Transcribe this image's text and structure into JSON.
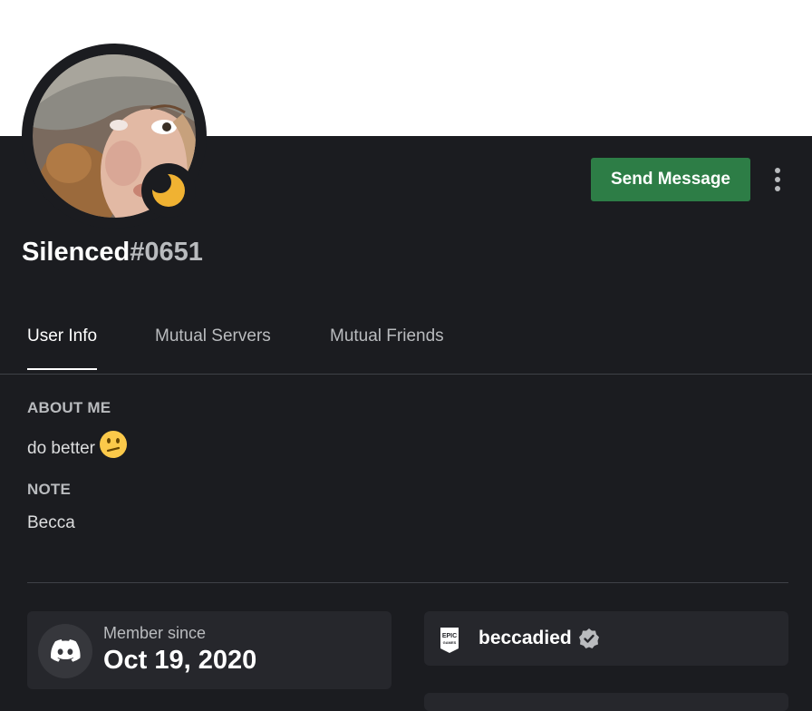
{
  "profile": {
    "username": "Silenced",
    "discriminator": "#0651",
    "status": "idle"
  },
  "actions": {
    "send_message_label": "Send Message"
  },
  "tabs": [
    {
      "label": "User Info",
      "active": true
    },
    {
      "label": "Mutual Servers",
      "active": false
    },
    {
      "label": "Mutual Friends",
      "active": false
    }
  ],
  "about": {
    "title": "ABOUT ME",
    "text": "do better",
    "emoji_icon": "confused-face-icon"
  },
  "note": {
    "title": "NOTE",
    "text": "Becca"
  },
  "member_since": {
    "label": "Member since",
    "date": "Oct 19, 2020",
    "icon": "discord-logo-icon"
  },
  "connections": [
    {
      "service": "Epic Games",
      "service_icon": "epic-games-icon",
      "name": "beccadied",
      "verified": true
    }
  ],
  "colors": {
    "background": "#1b1c20",
    "banner": "#ffffff",
    "send_button": "#2d7d46",
    "idle_status": "#f0b232",
    "card": "#26272c"
  }
}
